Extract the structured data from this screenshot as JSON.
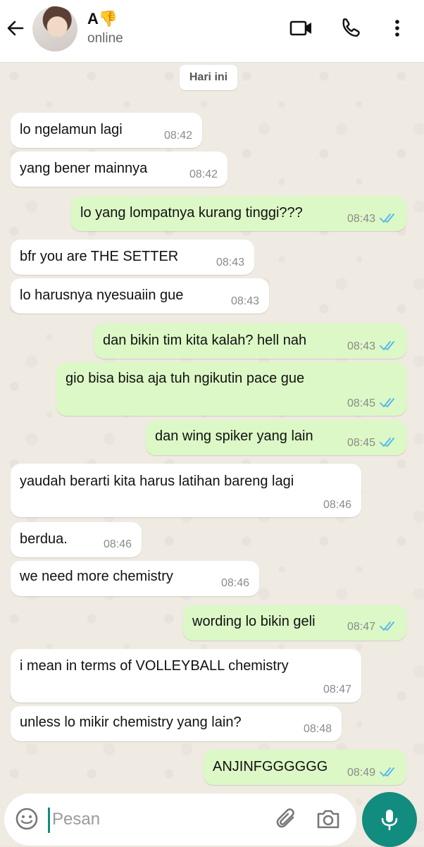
{
  "header": {
    "contact_name": "A",
    "name_emoji": "👎",
    "status": "online"
  },
  "date_chip": "Hari ini",
  "messages": [
    {
      "dir": "in",
      "text": "lo ngelamun lagi",
      "time": "08:42"
    },
    {
      "dir": "in",
      "text": "yang bener mainnya",
      "time": "08:42"
    },
    {
      "dir": "out",
      "text": "lo yang lompatnya kurang tinggi???",
      "time": "08:43"
    },
    {
      "dir": "in",
      "text": "bfr you are THE SETTER",
      "time": "08:43"
    },
    {
      "dir": "in",
      "text": "lo harusnya nyesuaiin gue",
      "time": "08:43"
    },
    {
      "dir": "out",
      "text": "dan bikin tim kita kalah? hell nah",
      "time": "08:43"
    },
    {
      "dir": "out",
      "text": "gio bisa bisa aja tuh ngikutin pace gue",
      "time": "08:45"
    },
    {
      "dir": "out",
      "text": "dan wing spiker yang lain",
      "time": "08:45"
    },
    {
      "dir": "in",
      "text": "yaudah berarti kita harus latihan bareng lagi",
      "time": "08:46"
    },
    {
      "dir": "in",
      "text": "berdua.",
      "time": "08:46"
    },
    {
      "dir": "in",
      "text": "we need more chemistry",
      "time": "08:46"
    },
    {
      "dir": "out",
      "text": "wording lo bikin geli",
      "time": "08:47"
    },
    {
      "dir": "in",
      "text": "i mean in terms of VOLLEYBALL chemistry",
      "time": "08:47"
    },
    {
      "dir": "in",
      "text": "unless lo mikir chemistry yang lain?",
      "time": "08:48"
    },
    {
      "dir": "out",
      "text": "ANJINFGGGGGG",
      "time": "08:49"
    }
  ],
  "composer": {
    "placeholder": "Pesan"
  },
  "icons": {
    "back": "arrow-left-icon",
    "video": "video-call-icon",
    "call": "phone-icon",
    "menu": "more-vertical-icon",
    "emoji": "emoji-icon",
    "attach": "paperclip-icon",
    "camera": "camera-icon",
    "mic": "microphone-icon",
    "read_receipt": "double-check-icon"
  },
  "colors": {
    "outgoing_bubble": "#dcf8c6",
    "incoming_bubble": "#ffffff",
    "accent": "#128c7e",
    "read_tick": "#4fb6ec"
  }
}
